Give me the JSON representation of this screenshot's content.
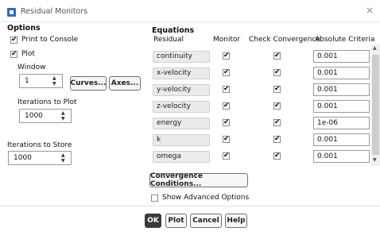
{
  "window": {
    "title": "Residual Monitors",
    "close": "×"
  },
  "options": {
    "header": "Options",
    "print_to_console": {
      "label": "Print to Console",
      "checked": true
    },
    "plot": {
      "label": "Plot",
      "checked": true
    },
    "window_label": "Window",
    "window_value": "1",
    "curves_button": "Curves...",
    "axes_button": "Axes...",
    "iterations_to_plot_label": "Iterations to Plot",
    "iterations_to_plot_value": "1000",
    "iterations_to_store_label": "Iterations to Store",
    "iterations_to_store_value": "1000"
  },
  "equations": {
    "header": "Equations",
    "columns": [
      "Residual",
      "Monitor",
      "Check Convergence",
      "Absolute Criteria"
    ],
    "rows": [
      {
        "residual": "continuity",
        "monitor": true,
        "check": true,
        "criteria": "0.001"
      },
      {
        "residual": "x-velocity",
        "monitor": true,
        "check": true,
        "criteria": "0.001"
      },
      {
        "residual": "y-velocity",
        "monitor": true,
        "check": true,
        "criteria": "0.001"
      },
      {
        "residual": "z-velocity",
        "monitor": true,
        "check": true,
        "criteria": "0.001"
      },
      {
        "residual": "energy",
        "monitor": true,
        "check": true,
        "criteria": "1e-06"
      },
      {
        "residual": "k",
        "monitor": true,
        "check": true,
        "criteria": "0.001"
      },
      {
        "residual": "omega",
        "monitor": true,
        "check": true,
        "criteria": "0.001"
      }
    ],
    "convergence_button": "Convergence Conditions...",
    "advanced": {
      "label": "Show Advanced Options",
      "checked": false
    }
  },
  "footer": {
    "ok": "OK",
    "plot": "Plot",
    "cancel": "Cancel",
    "help": "Help"
  },
  "colors": {
    "accent": "#2b6cc4",
    "ok_button": "#3a3a3a"
  }
}
